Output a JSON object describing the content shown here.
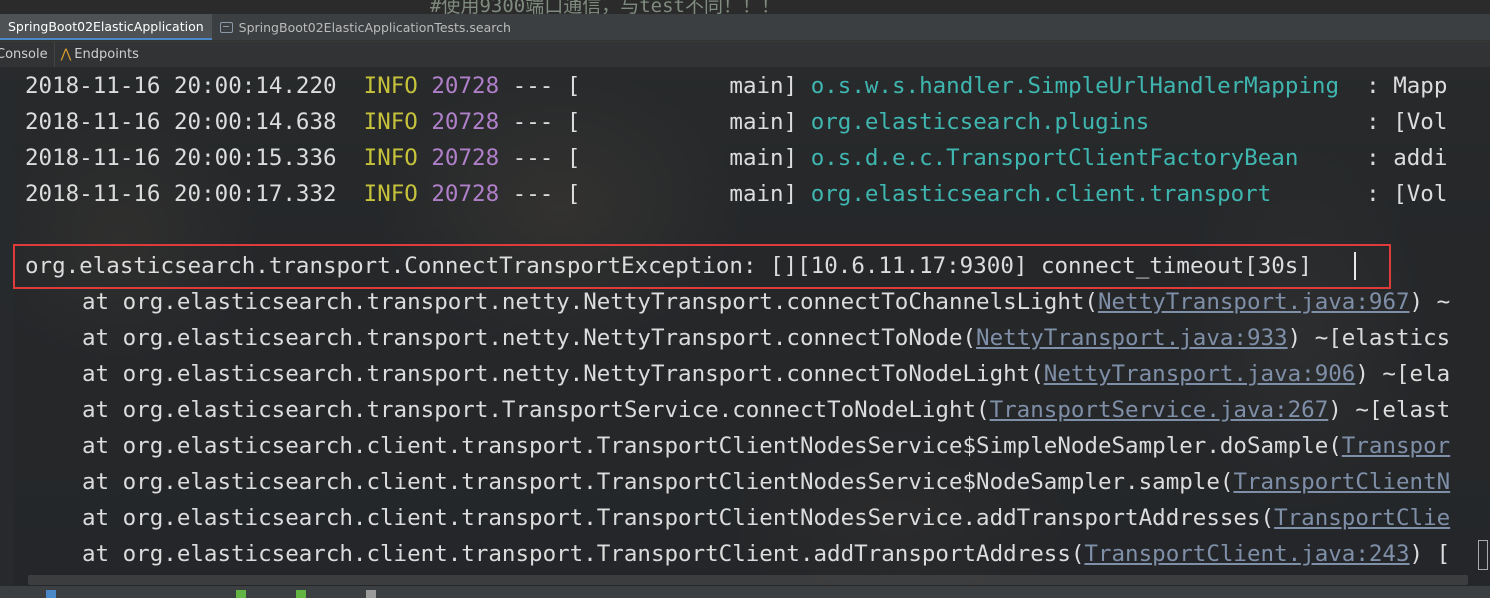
{
  "editor": {
    "partial_comment": "#使用9300端口通信，与test不同！！！"
  },
  "run_tabs": [
    {
      "label": "SpringBoot02ElasticApplication",
      "active": true
    },
    {
      "label": "SpringBoot02ElasticApplicationTests.search",
      "active": false
    }
  ],
  "sub_tabs": {
    "console": "Console",
    "endpoints": "Endpoints"
  },
  "log_lines": [
    {
      "ts": "2018-11-16 20:00:14.220",
      "level": "INFO",
      "pid": "20728",
      "sep": "--- [",
      "thread": "main]",
      "logger": "o.s.w.s.handler.SimpleUrlHandlerMapping",
      "msg": ": Mapp"
    },
    {
      "ts": "2018-11-16 20:00:14.638",
      "level": "INFO",
      "pid": "20728",
      "sep": "--- [",
      "thread": "main]",
      "logger": "org.elasticsearch.plugins",
      "msg": ": [Vol"
    },
    {
      "ts": "2018-11-16 20:00:15.336",
      "level": "INFO",
      "pid": "20728",
      "sep": "--- [",
      "thread": "main]",
      "logger": "o.s.d.e.c.TransportClientFactoryBean",
      "msg": ": addi"
    },
    {
      "ts": "2018-11-16 20:00:17.332",
      "level": "INFO",
      "pid": "20728",
      "sep": "--- [",
      "thread": "main]",
      "logger": "org.elasticsearch.client.transport",
      "msg": ": [Vol"
    }
  ],
  "exception": "org.elasticsearch.transport.ConnectTransportException: [][10.6.11.17:9300] connect_timeout[30s]",
  "trace": [
    {
      "prefix": "at org.elasticsearch.transport.netty.NettyTransport.connectToChannelsLight(",
      "link": "NettyTransport.java:967",
      "suffix": ") ~"
    },
    {
      "prefix": "at org.elasticsearch.transport.netty.NettyTransport.connectToNode(",
      "link": "NettyTransport.java:933",
      "suffix": ") ~[elastics"
    },
    {
      "prefix": "at org.elasticsearch.transport.netty.NettyTransport.connectToNodeLight(",
      "link": "NettyTransport.java:906",
      "suffix": ") ~[ela"
    },
    {
      "prefix": "at org.elasticsearch.transport.TransportService.connectToNodeLight(",
      "link": "TransportService.java:267",
      "suffix": ") ~[elast"
    },
    {
      "prefix": "at org.elasticsearch.client.transport.TransportClientNodesService$SimpleNodeSampler.doSample(",
      "link": "Transpor",
      "suffix": ""
    },
    {
      "prefix": "at org.elasticsearch.client.transport.TransportClientNodesService$NodeSampler.sample(",
      "link": "TransportClientN",
      "suffix": ""
    },
    {
      "prefix": "at org.elasticsearch.client.transport.TransportClientNodesService.addTransportAddresses(",
      "link": "TransportClie",
      "suffix": ""
    },
    {
      "prefix": "at org.elasticsearch.client.transport.TransportClient.addTransportAddress(",
      "link": "TransportClient.java:243",
      "suffix": ") ["
    }
  ],
  "colors": {
    "info": "#c7c23b",
    "pid": "#b07fc9",
    "logger": "#3fb6b0",
    "highlight_border": "#e03b3b",
    "link": "#7f8fa8"
  }
}
